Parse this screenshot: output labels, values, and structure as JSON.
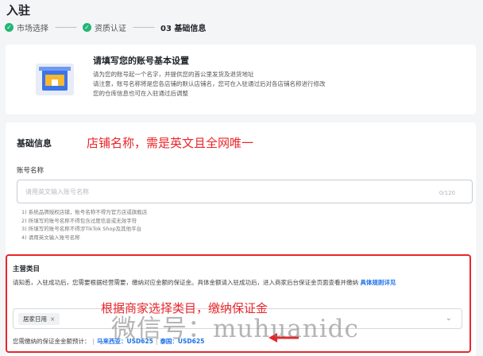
{
  "page": {
    "title": "入驻"
  },
  "steps": [
    {
      "label": "市场选择",
      "done": true
    },
    {
      "label": "资质认证",
      "done": true
    },
    {
      "label": "03 基础信息",
      "done": false
    }
  ],
  "intro": {
    "title": "请填写您的账号基本设置",
    "lines": [
      "请为您的账号起一个名字，并提供您的首公里发货及退货地址",
      "请注意，账号名称将是您各店铺的默认店铺名，您可在入驻通过后对各店铺名称进行修改",
      "您的仓库信息也可在入驻通过后调整"
    ]
  },
  "basic": {
    "section_title": "基础信息",
    "annotation": "店铺名称，需是英文且全网唯一",
    "account_name_label": "账号名称",
    "account_name_placeholder": "请用英文输入账号名称",
    "counter": "0/120",
    "rules": [
      "1) 系统品牌授权店铺，账号名称不得为官方店或旗舰店",
      "2) 所填写的账号名称不得包含过度信息或无效字符",
      "3) 所填写的账号名称不得涉TikTok Shop及其他平台",
      "4) 请用英文输入账号名称"
    ]
  },
  "category": {
    "title": "主营类目",
    "desc": "请知悉，入驻成功后，您需要根据经营需要，缴纳对应金额的保证金。具体金额请入驻成功后，进入商家后台保证金页面查看并缴纳",
    "link": "具体规则详见",
    "annotation": "根据商家选择类目，缴纳保证金",
    "selected_tag": "居家日用",
    "deposit_prefix": "您需缴纳的保证金金额预计：",
    "deposit_items": [
      "马来西亚：USD625",
      "泰国：USD625"
    ]
  },
  "overlay": {
    "watermark": "微信号：muhuanidc"
  },
  "colors": {
    "annotation": "#e8262a",
    "link": "#1d6fe8",
    "check": "#22b573"
  }
}
